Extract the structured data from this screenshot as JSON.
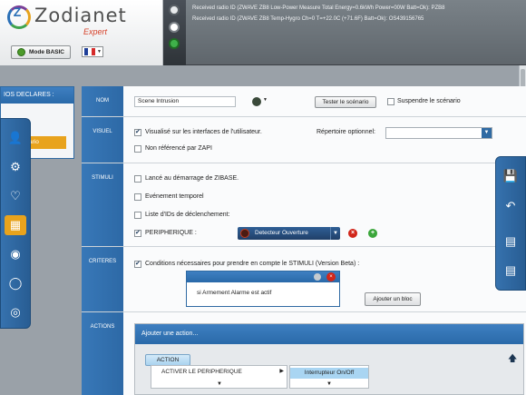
{
  "header": {
    "logo_text": "Zodianet",
    "logo_sub": "Expert",
    "mode_button": "Mode BASIC",
    "log_lines": [
      "Received radio ID (ZWAVE ZB8 Low-Power Measure Total Energy=0.6kWh Power=00W Batt=Ok): PZB8",
      "Received radio ID (ZWAVE ZB8 Temp-Hygro Ch=0 T=+22.0C (+71.6F) Batt=Ok): OS439156765"
    ]
  },
  "left_panel": {
    "title": "IOS DECLARES :",
    "selected_item": "ario"
  },
  "sidebar_icons": [
    "user-icon",
    "gear-icon",
    "bell-icon",
    "scenario-icon",
    "camera-icon",
    "zodianet-icon",
    "eye-icon"
  ],
  "form": {
    "labels": {
      "nom": "NOM",
      "visuel": "VISUEL",
      "stimuli": "STIMULI",
      "criteres": "CRITERES",
      "actions": "ACTIONS"
    },
    "name_value": "Scene Intrusion",
    "test_button": "Tester le scénario",
    "suspend_label": "Suspendre le scénario",
    "visuel_show": "Visualisé sur les interfaces de l'utilisateur.",
    "visuel_zapi": "Non référencé par ZAPI",
    "repertoire_label": "Répertoire optionnel:",
    "stimuli": {
      "startup": "Lancé au démarrage de ZIBASE.",
      "temporal": "Evénement temporel",
      "ids": "Liste d'IDs de déclenchement:",
      "periph_label": "PERIPHERIQUE :",
      "periph_value": "Detecteur Ouverture"
    },
    "criteres": {
      "checkbox": "Conditions nécessaires pour prendre en compte le STIMULI (Version Beta) :",
      "condition": "si Armement Alarme est actif",
      "add_block": "Ajouter un bloc"
    },
    "actions": {
      "header": "Ajouter une action...",
      "action_button": "ACTION",
      "menu_item": "ACTIVER LE PERIPHERIQUE",
      "submenu_item": "Interrupteur On/Off"
    }
  },
  "right_toolbar": [
    "save-icon",
    "undo-icon",
    "add-list-icon",
    "remove-list-icon"
  ],
  "colors": {
    "accent_blue": "#2f6aa3",
    "highlight_orange": "#e8a31d",
    "status_green": "#3fb14a",
    "delete_red": "#d1261a"
  }
}
